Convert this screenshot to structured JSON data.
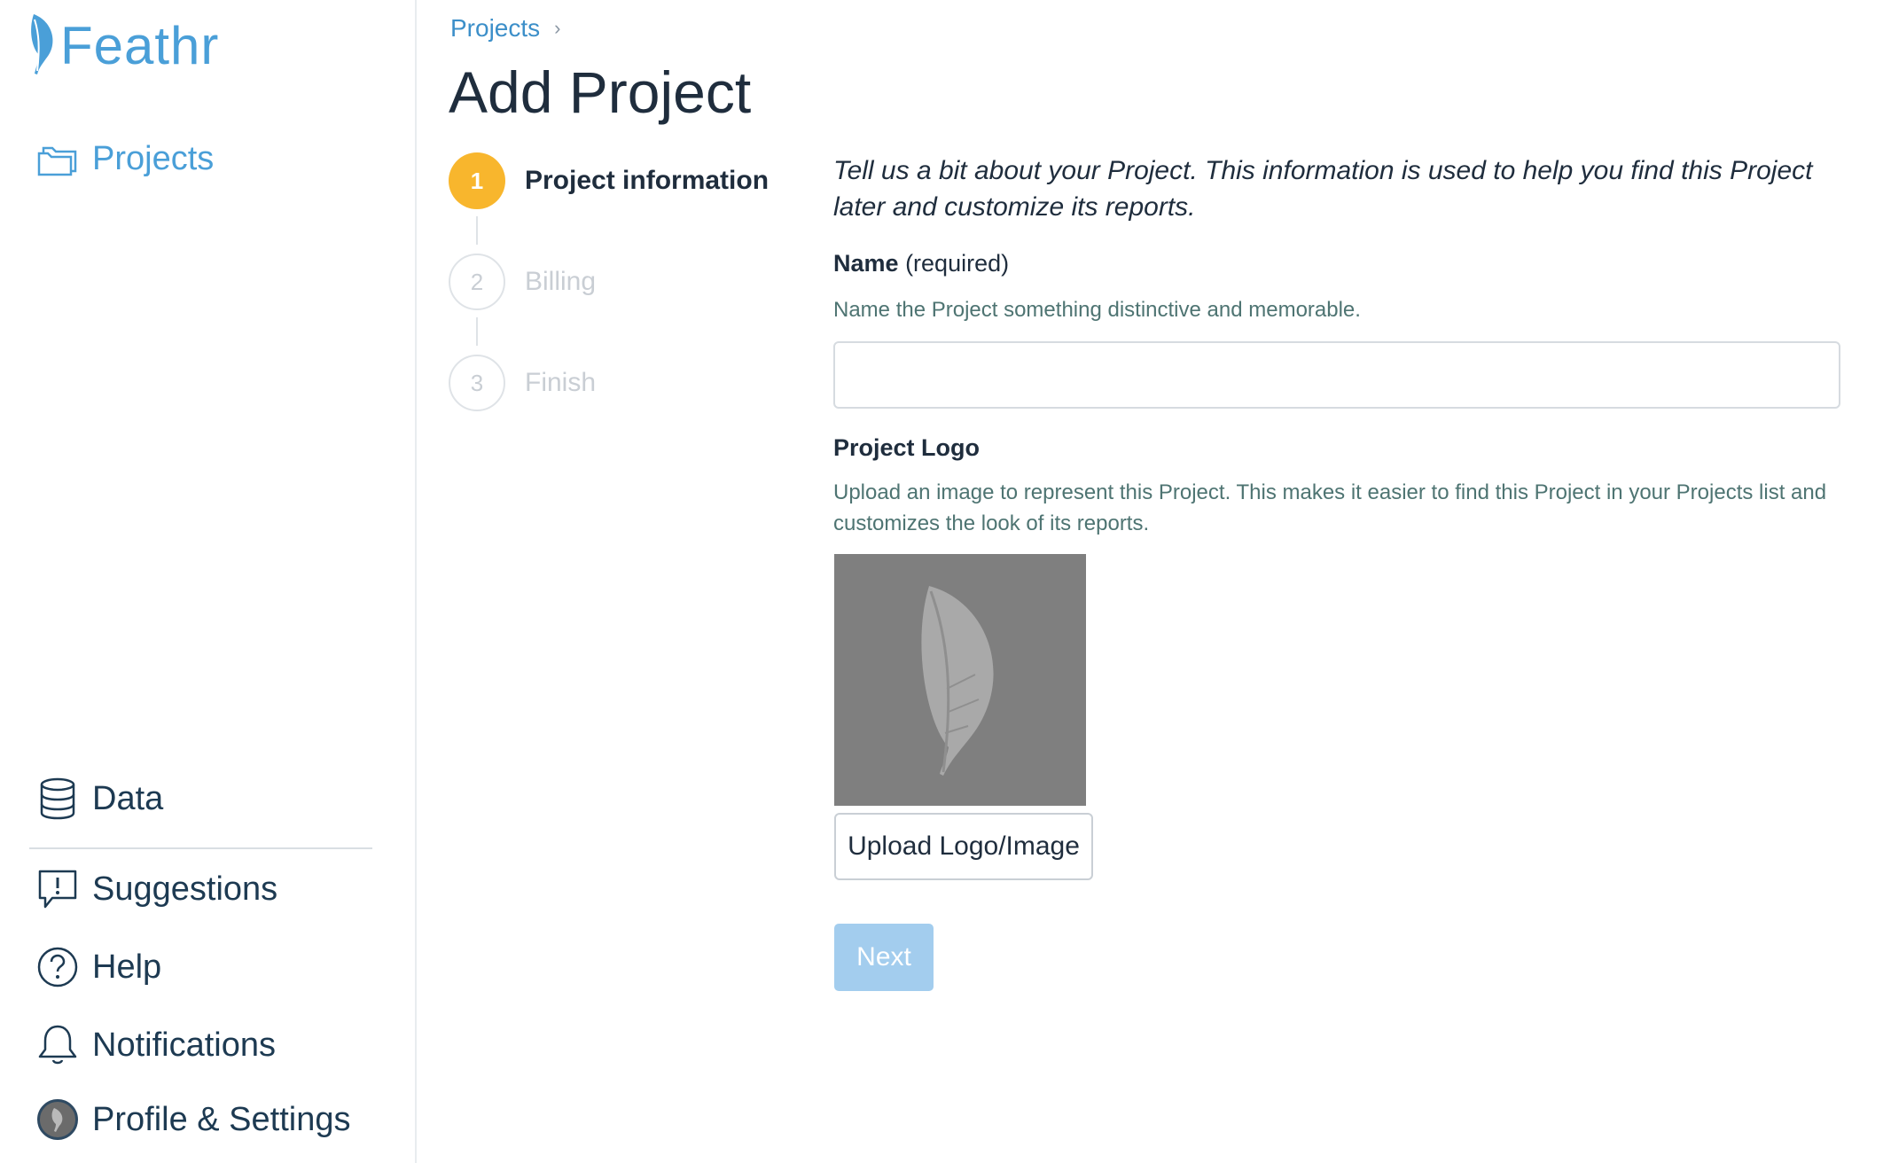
{
  "app": {
    "brand": "Feathr",
    "brand_color": "#4a9fd8"
  },
  "sidebar": {
    "primary": {
      "label": "Projects",
      "icon": "folders-icon"
    },
    "items": [
      {
        "label": "Data",
        "icon": "database-icon"
      },
      {
        "label": "Suggestions",
        "icon": "speech-bubble-exclamation-icon"
      },
      {
        "label": "Help",
        "icon": "question-circle-icon"
      },
      {
        "label": "Notifications",
        "icon": "bell-icon"
      },
      {
        "label": "Profile & Settings",
        "icon": "avatar"
      }
    ]
  },
  "breadcrumb": {
    "items": [
      "Projects"
    ],
    "separator": "›"
  },
  "page": {
    "title": "Add Project"
  },
  "stepper": {
    "active_color": "#f8b62d",
    "steps": [
      {
        "number": "1",
        "label": "Project information",
        "state": "active"
      },
      {
        "number": "2",
        "label": "Billing",
        "state": "inactive"
      },
      {
        "number": "3",
        "label": "Finish",
        "state": "inactive"
      }
    ]
  },
  "form": {
    "intro": "Tell us a bit about your Project. This information is used to help you find this Project later and customize its reports.",
    "name": {
      "label": "Name",
      "qualifier": "(required)",
      "help": "Name the Project something distinctive and memorable.",
      "value": "",
      "placeholder": ""
    },
    "logo": {
      "label": "Project Logo",
      "help": "Upload an image to represent this Project. This makes it easier to find this Project in your Projects list and customizes the look of its reports.",
      "placeholder_icon": "feather-icon",
      "upload_label": "Upload Logo/Image"
    },
    "next_label": "Next"
  }
}
